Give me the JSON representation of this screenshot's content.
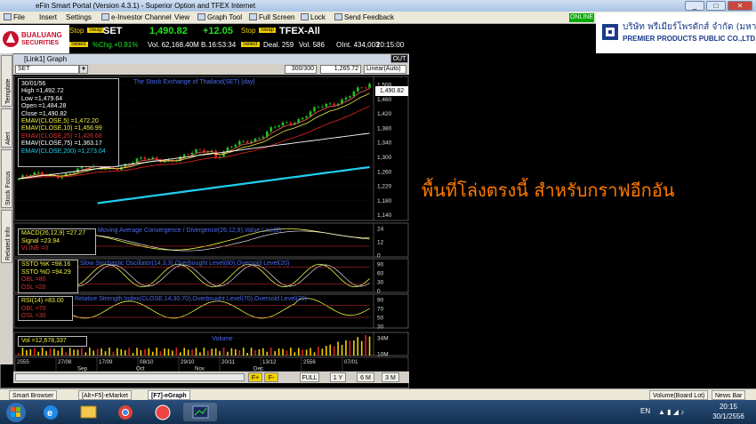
{
  "window": {
    "title": "eFin Smart Portal (Version 4.3.1) - Superior Option and TFEX Internet"
  },
  "menu": {
    "items": [
      "File",
      "Insert",
      "Settings",
      "e-Investor Channel",
      "View",
      "Graph Tool",
      "Full Screen",
      "Lock",
      "Send Feedback"
    ],
    "status": "ONLINE"
  },
  "broker": {
    "name": "BUALUANG",
    "sub": "SECURITIES"
  },
  "quote_set": {
    "stop_label": "Stop",
    "swap_label": "Swap",
    "select_label": "Select",
    "symbol": "SET",
    "price": "1,490.82",
    "change": "+12.05",
    "pct_change": "%Chg.+0.81%",
    "volume": "Vol. 62,168.40M B.",
    "time": "16:53:34"
  },
  "quote_tfex": {
    "symbol": "TFEX-All",
    "deal": "Deal. 259",
    "volume": "Vol. 586",
    "oint": "OInt. 434,003",
    "time": "20:15:00"
  },
  "premier": {
    "thai": "บริษัท พรีเมียร์โพรดักส์ จำกัด (มหาชน)",
    "en": "PREMIER PRODUCTS PUBLIC CO.,LTD."
  },
  "graph": {
    "title": "[Link1] Graph",
    "symbol": "SET",
    "count": "300/300",
    "last": "1,265.72",
    "scale": "Linear(Auto)",
    "out_label": "OUT",
    "chart_heading": "The Stock Exchange of Thailand(SET) [day]",
    "price_tag": "1,490.82",
    "side_tabs": [
      "Template",
      "Alert",
      "Stock Focus",
      "Related Info"
    ]
  },
  "ohlc_box": {
    "date": "30/01/56",
    "high": "High  =1,492.72",
    "low": "Low   =1,479.64",
    "open": "Open  =1,484.28",
    "close": "Close =1,490.82",
    "ema5": "EMAV(CLOSE,5)   =1,472.20",
    "ema10": "EMAV(CLOSE,10)  =1,456.99",
    "ema25": "EMAV(CLOSE,25)  =1,426.68",
    "ema75": "EMAV(CLOSE,75)  =1,363.17",
    "ema200": "EMAV(CLOSE,200) =1,273.04"
  },
  "macd_box": {
    "macd": "MACD(26,12,9)  =27.27",
    "signal": "Signal   =23.94",
    "vline": "VLINE   =0",
    "title": "Moving Average Convergence / Divergence(26,12,9),Value Line(0)"
  },
  "ssto_box": {
    "k": "SSTO %K  =98.16",
    "d": "SSTO %D  =94.29",
    "obl": "OBL   =80",
    "osl": "OSL   =20",
    "title": "Slow Stochastic Oscillator(14,3,3),Overbought Level(80),Oversold Level(20)"
  },
  "rsi_box": {
    "rsi": "RSI(14)  =83.00",
    "obl": "OBL   =70",
    "osl": "OSL   =30",
    "title": "Relative Strength Index(CLOSE,14,30,70),Overbought Level(70),Oversold Level(30)"
  },
  "vol_box": {
    "vol": "Vol   =12,678,337",
    "title": "Volume"
  },
  "axes": {
    "price": [
      "1,500",
      "1,460",
      "1,420",
      "1,380",
      "1,340",
      "1,300",
      "1,260",
      "1,220",
      "1,180",
      "1,140"
    ],
    "macd": [
      "24",
      "12",
      "0"
    ],
    "ssto": [
      "90",
      "60",
      "30",
      "0"
    ],
    "rsi": [
      "90",
      "70",
      "50",
      "30"
    ],
    "volume": [
      "34M",
      "10M"
    ],
    "dates_top": [
      "2555",
      "27/08",
      "17/09",
      "08/10",
      "29/10",
      "20/11",
      "13/12",
      "2556",
      "07/01"
    ],
    "dates_bottom": [
      "Sep",
      "Oct",
      "Nov",
      "Dec"
    ]
  },
  "period_buttons": [
    "FULL",
    "1 Y",
    "6 M",
    "3 M"
  ],
  "colors": {
    "ema5": "#ff6060",
    "ema10": "#f0f040",
    "ema25": "#d02020",
    "ema75": "#ffffff",
    "ema200": "#20d0f0",
    "candle_up": "#20c020",
    "candle_down": "#e02020",
    "panel_bg": "#000000"
  },
  "app_tabs": [
    "Smart Browser",
    "[Alt+F5]-eMarket",
    "[F7]-eGraph",
    "Volume(Board Lot)",
    "News Bar"
  ],
  "taskbar": {
    "lang": "EN",
    "time": "20:15",
    "date": "30/1/2556"
  },
  "placeholder_text": "พื้นที่โล่งตรงนี้ สำหรับกราฟอีกอัน"
}
